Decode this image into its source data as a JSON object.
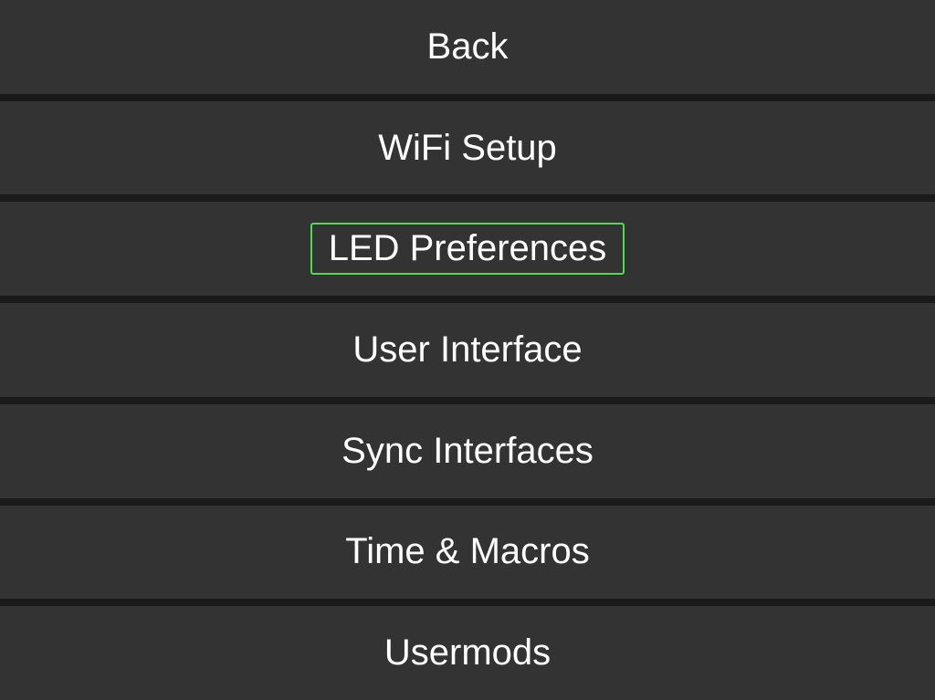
{
  "menu": {
    "items": [
      {
        "label": "Back",
        "selected": false
      },
      {
        "label": "WiFi Setup",
        "selected": false
      },
      {
        "label": "LED Preferences",
        "selected": true
      },
      {
        "label": "User Interface",
        "selected": false
      },
      {
        "label": "Sync Interfaces",
        "selected": false
      },
      {
        "label": "Time & Macros",
        "selected": false
      },
      {
        "label": "Usermods",
        "selected": false
      }
    ]
  },
  "colors": {
    "background": "#1a1a1a",
    "itemBackground": "#333333",
    "text": "#ffffff",
    "selectedBorder": "#4fdd4f"
  }
}
